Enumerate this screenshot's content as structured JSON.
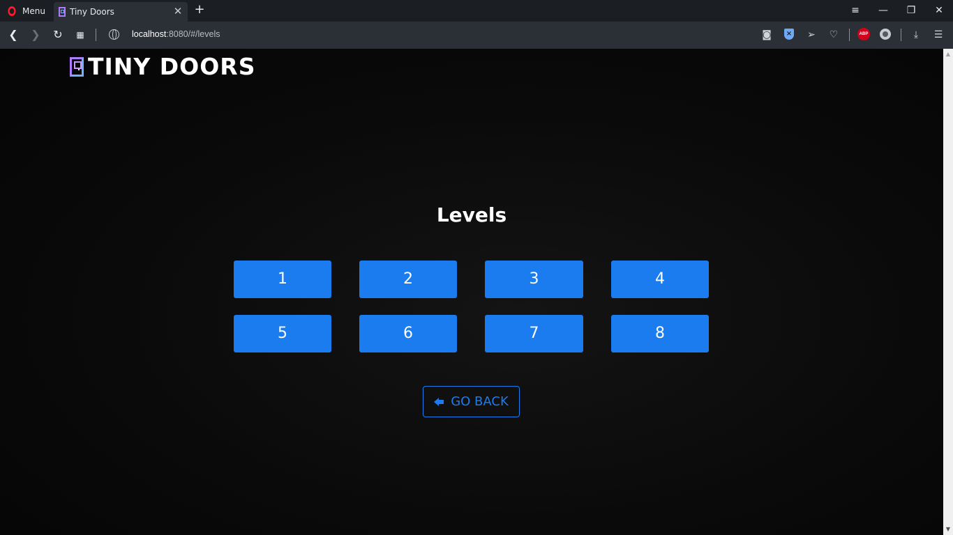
{
  "browser": {
    "menu_label": "Menu",
    "tab_title": "Tiny Doors",
    "url_host": "localhost",
    "url_rest": ":8080/#/levels"
  },
  "icons": {
    "back": "arrow-left-icon",
    "forward": "arrow-right-icon",
    "reload": "reload-icon",
    "tabs_grid": "grid-icon",
    "camera": "camera-icon",
    "shield": "shield-icon",
    "send": "send-icon",
    "heart": "heart-icon",
    "adblock": "adblock-icon",
    "download": "download-icon",
    "easy_setup": "settings-sliders-icon"
  },
  "adblock_label": "ABP",
  "page": {
    "brand": "TINY DOORS",
    "title": "Levels",
    "levels": [
      "1",
      "2",
      "3",
      "4",
      "5",
      "6",
      "7",
      "8"
    ],
    "go_back_label": "GO BACK"
  },
  "colors": {
    "accent": "#1a7cee",
    "background": "#0a0a0a",
    "browser_chrome": "#2b3036"
  }
}
